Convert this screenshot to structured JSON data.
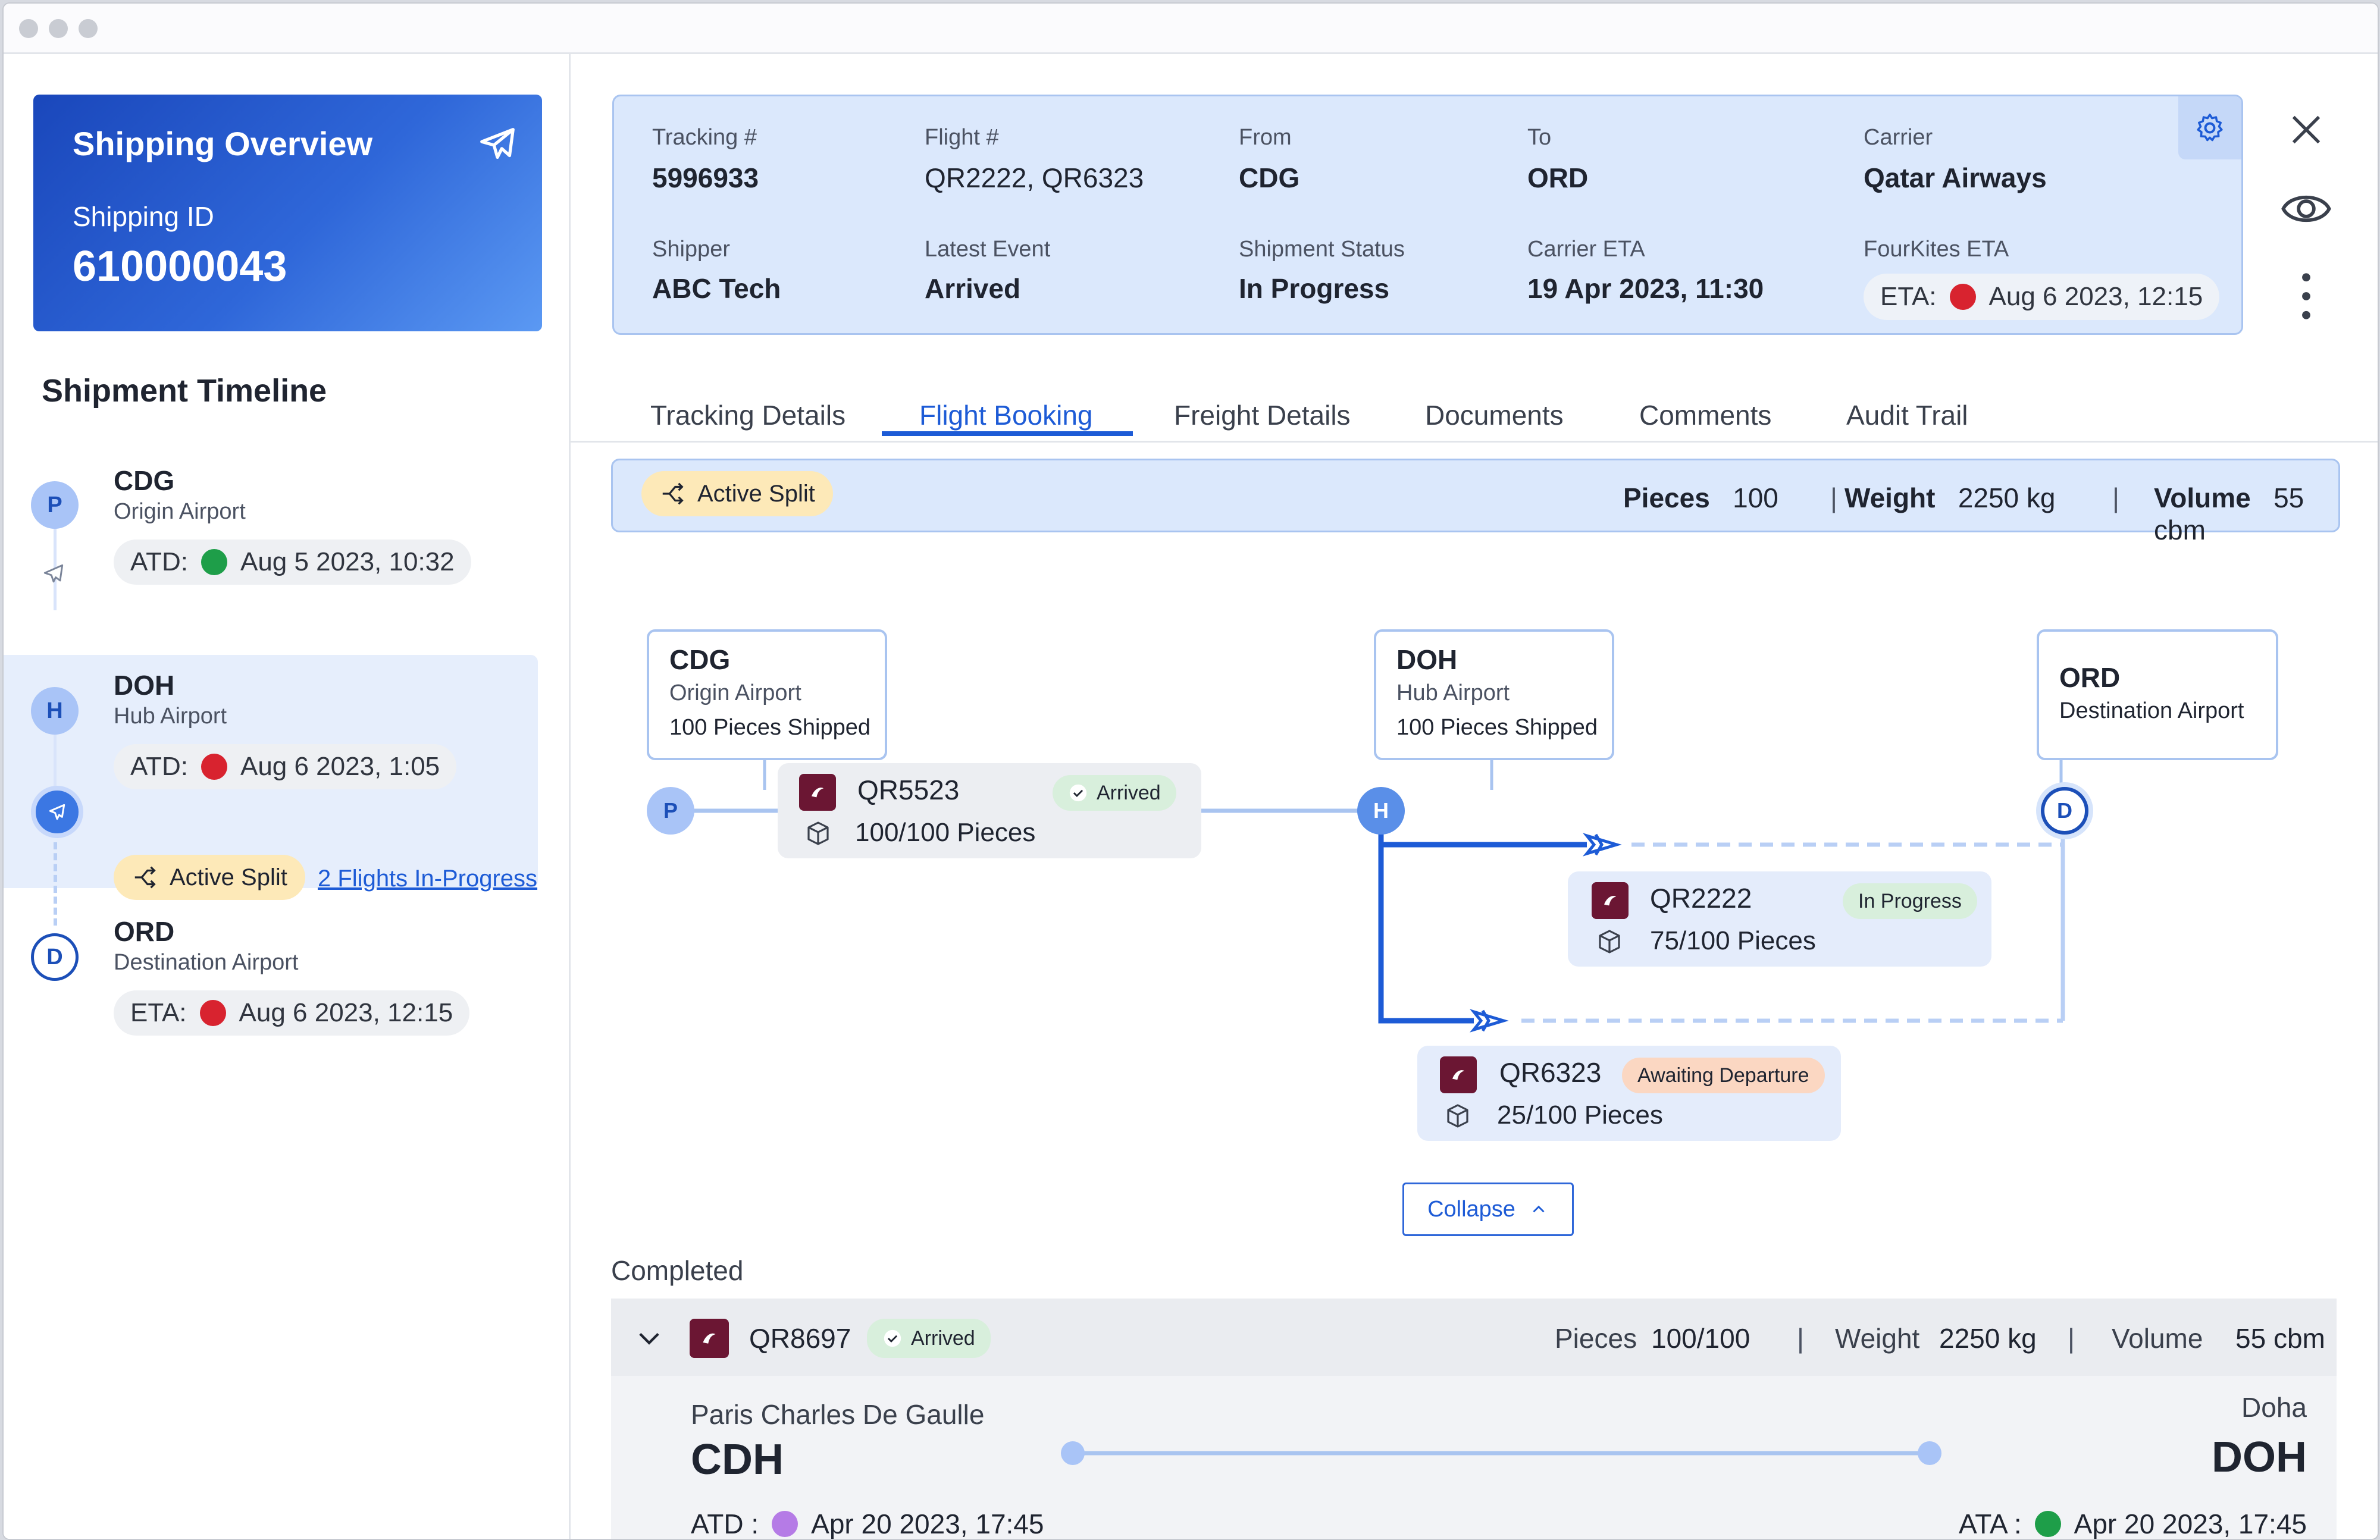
{
  "window": {
    "controls": [
      "close",
      "minimize",
      "maximize"
    ]
  },
  "sidebar": {
    "overview": {
      "title": "Shipping Overview",
      "id_label": "Shipping ID",
      "id_value": "610000043",
      "icon": "plane-icon"
    },
    "timeline_title": "Shipment Timeline",
    "stops": [
      {
        "marker": "P",
        "code": "CDG",
        "name": "Origin Airport",
        "time_label": "ATD:",
        "status_color": "#1e9e49",
        "time": "Aug 5 2023, 10:32"
      },
      {
        "marker": "H",
        "code": "DOH",
        "name": "Hub Airport",
        "time_label": "ATD:",
        "status_color": "#d8232f",
        "time": "Aug 6 2023, 1:05",
        "split_label": "Active Split",
        "split_link": "2 Flights In-Progress"
      },
      {
        "marker": "D",
        "code": "ORD",
        "name": "Destination Airport",
        "time_label": "ETA:",
        "status_color": "#d8232f",
        "time": "Aug 6 2023, 12:15"
      }
    ]
  },
  "summary": {
    "tracking_label": "Tracking #",
    "tracking": "5996933",
    "flight_label": "Flight #",
    "flight": "QR2222, QR6323",
    "from_label": "From",
    "from": "CDG",
    "to_label": "To",
    "to": "ORD",
    "carrier_label": "Carrier",
    "carrier": "Qatar Airways",
    "shipper_label": "Shipper",
    "shipper": "ABC Tech",
    "latest_event_label": "Latest Event",
    "latest_event": "Arrived",
    "status_label": "Shipment Status",
    "status": "In Progress",
    "carrier_eta_label": "Carrier ETA",
    "carrier_eta": "19 Apr 2023, 11:30",
    "fk_eta_label": "FourKites ETA",
    "fk_eta_prefix": "ETA:",
    "fk_eta_color": "#d8232f",
    "fk_eta": "Aug 6 2023, 12:15"
  },
  "tabs": [
    "Tracking Details",
    "Flight Booking",
    "Freight Details",
    "Documents",
    "Comments",
    "Audit Trail"
  ],
  "active_tab": "Flight Booking",
  "split_bar": {
    "label": "Active Split",
    "pieces_label": "Pieces",
    "pieces": "100",
    "weight_label": "Weight",
    "weight": "2250 kg",
    "volume_label": "Volume",
    "volume": "55 cbm",
    "separator": "|"
  },
  "route": {
    "origin": {
      "code": "CDG",
      "name": "Origin Airport",
      "shipped": "100 Pieces Shipped",
      "marker": "P"
    },
    "hub": {
      "code": "DOH",
      "name": "Hub Airport",
      "shipped": "100 Pieces Shipped",
      "marker": "H"
    },
    "destination": {
      "code": "ORD",
      "name": "Destination  Airport",
      "marker": "D"
    },
    "flights": [
      {
        "number": "QR5523",
        "status": "Arrived",
        "pieces": "100/100 Pieces"
      },
      {
        "number": "QR2222",
        "status": "In Progress",
        "pieces": "75/100 Pieces"
      },
      {
        "number": "QR6323",
        "status": "Awaiting Departure",
        "pieces": "25/100 Pieces"
      }
    ],
    "collapse_label": "Collapse"
  },
  "completed": {
    "title": "Completed",
    "flight": "QR8697",
    "status": "Arrived",
    "pieces_label": "Pieces",
    "pieces": "100/100",
    "weight_label": "Weight",
    "weight": "2250 kg",
    "volume_label": "Volume",
    "volume": "55 cbm",
    "separator": "|",
    "from_name": "Paris Charles De Gaulle",
    "from_code": "CDH",
    "to_name": "Doha",
    "to_code": "DOH",
    "atd_label": "ATD :",
    "atd_color": "#b57be6",
    "atd": "Apr 20 2023, 17:45",
    "ata_label": "ATA :",
    "ata_color": "#1e9e49",
    "ata": "Apr 20 2023, 17:45"
  },
  "colors": {
    "accent": "#1d5bd6",
    "panel": "#dbe8fc",
    "qatar": "#6b1633"
  }
}
